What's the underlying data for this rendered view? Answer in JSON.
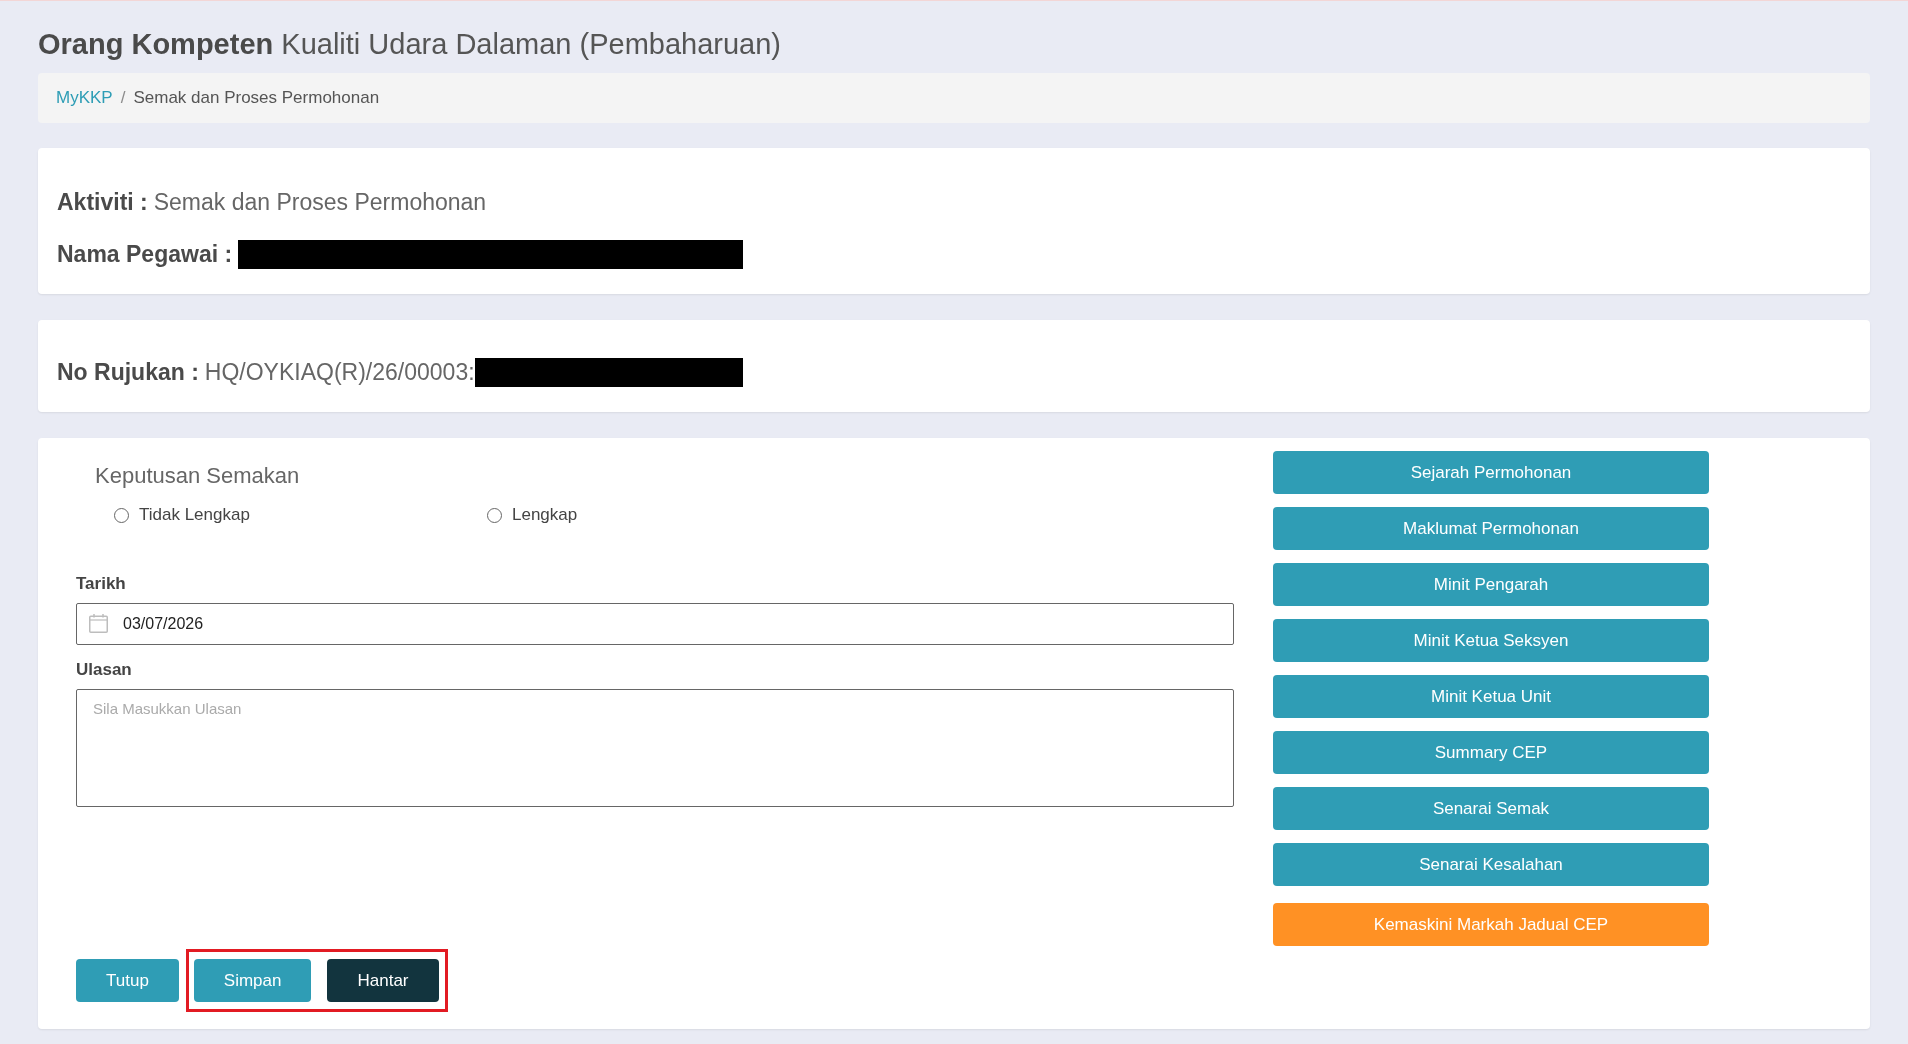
{
  "page_title": "**Orang Kompeten** Kualiti Udara Dalaman (Pembaharuan)",
  "breadcrumb": {
    "separator": "/",
    "items": [
      {
        "label": "MyKKP",
        "kind": "link"
      },
      {
        "label": "Semak dan Proses Permohonan",
        "kind": "current"
      }
    ]
  },
  "activity_card": {
    "fields": [
      {
        "label": "Aktiviti :",
        "value": "Semak dan Proses Permohonan",
        "redacted": false
      },
      {
        "label": "Nama Pegawai :",
        "redacted": true
      }
    ]
  },
  "reference_card": {
    "fields": [
      {
        "label": "No Rujukan :",
        "value": "HQ/OYKIAQ(R)/26/00003:",
        "redacted": true
      }
    ]
  },
  "review_form": {
    "decision": {
      "title": "Keputusan Semakan",
      "options": [
        {
          "label": "Tidak Lengkap",
          "selected": false
        },
        {
          "label": "Lengkap",
          "selected": false
        }
      ]
    },
    "date": {
      "label": "Tarikh",
      "value": "03/07/2026"
    },
    "comment": {
      "label": "Ulasan",
      "placeholder": "Sila Masukkan Ulasan"
    }
  },
  "side_buttons": [
    {
      "label": "Sejarah Permohonan",
      "kind": "info"
    },
    {
      "label": "Maklumat Permohonan",
      "kind": "info"
    },
    {
      "label": "Minit Pengarah",
      "kind": "info"
    },
    {
      "label": "Minit Ketua Seksyen",
      "kind": "info"
    },
    {
      "label": "Minit Ketua Unit",
      "kind": "info"
    },
    {
      "label": "Summary CEP",
      "kind": "info"
    },
    {
      "label": "Senarai Semak",
      "kind": "info"
    },
    {
      "label": "Senarai Kesalahan",
      "kind": "info"
    },
    {
      "label": "Kemaskini Markah Jadual CEP",
      "kind": "warning"
    }
  ],
  "footer_buttons": [
    {
      "label": "Tutup",
      "kind": "info",
      "highlighted": false
    },
    {
      "label": "Simpan",
      "kind": "info",
      "highlighted": true
    },
    {
      "label": "Hantar",
      "kind": "dark",
      "highlighted": true
    }
  ]
}
